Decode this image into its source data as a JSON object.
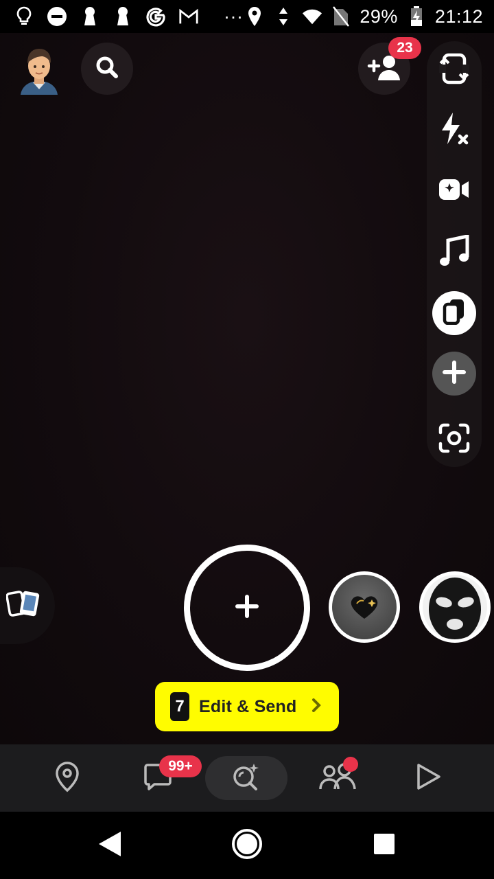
{
  "status_bar": {
    "battery": "29%",
    "time": "21:12",
    "overflow": "···",
    "icons": [
      "lightbulb-icon",
      "do-not-disturb-icon",
      "keyhole-icon",
      "keyhole-icon",
      "google-g-icon",
      "gmail-icon",
      "location-icon",
      "data-arrows-icon",
      "wifi-icon",
      "no-sim-icon",
      "battery-charging-icon"
    ]
  },
  "top_bar": {
    "avatar": "avatar",
    "search": "search-icon",
    "add_friend": "add-friend-icon",
    "friend_requests_count": "23"
  },
  "tools": [
    "flip-camera-icon",
    "flash-off-icon",
    "video-chat-icon",
    "music-note-icon",
    "multi-snap-icon",
    "plus-icon",
    "scan-icon"
  ],
  "camera": {
    "capture_icon": "plus-icon",
    "memories": "memories-icon",
    "lenses": [
      "heart-lens",
      "ski-mask-lens"
    ]
  },
  "edit_send": {
    "count": "7",
    "label": "Edit & Send"
  },
  "bottom_nav": {
    "items": [
      "map",
      "chat",
      "camera-spotlight",
      "stories",
      "discover"
    ],
    "chat_badge": "99+"
  },
  "system_nav": [
    "back",
    "home",
    "recents"
  ],
  "colors": {
    "accent_yellow": "#fffc00",
    "badge_red": "#e8334a",
    "nav_bg": "#1c1c1e"
  }
}
